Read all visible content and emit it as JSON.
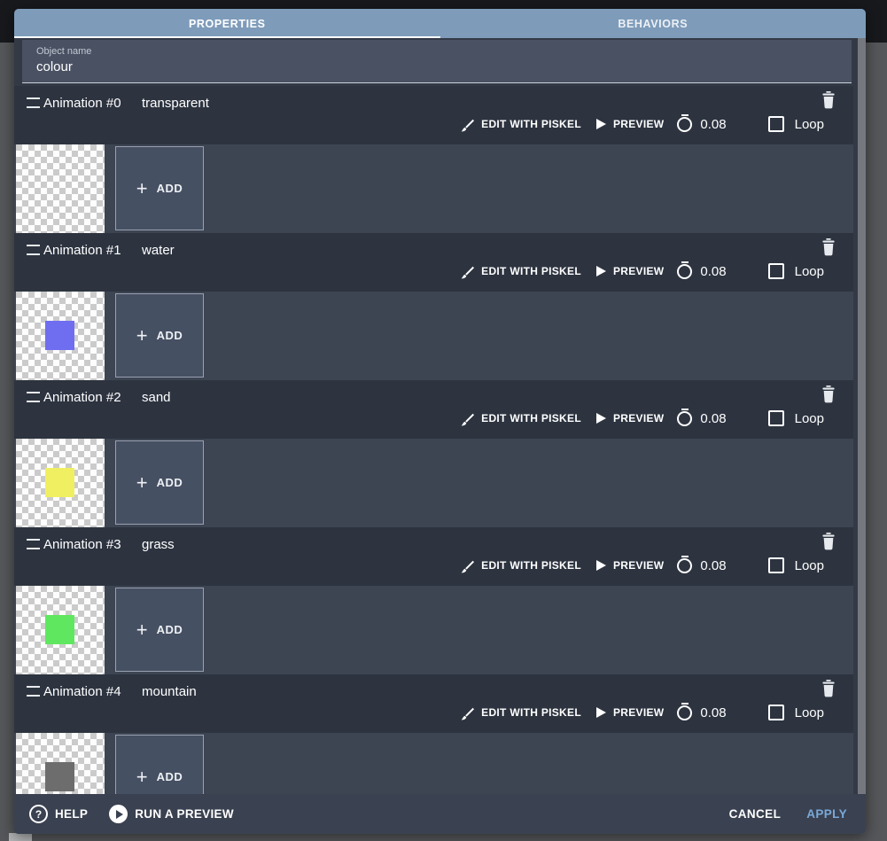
{
  "tabs": {
    "properties": "PROPERTIES",
    "behaviors": "BEHAVIORS"
  },
  "object_name": {
    "label": "Object name",
    "value": "colour"
  },
  "animations": [
    {
      "title": "Animation #0",
      "name": "transparent",
      "color": null,
      "time": "0.08"
    },
    {
      "title": "Animation #1",
      "name": "water",
      "color": "#6f6ef0",
      "time": "0.08"
    },
    {
      "title": "Animation #2",
      "name": "sand",
      "color": "#f0ef62",
      "time": "0.08"
    },
    {
      "title": "Animation #3",
      "name": "grass",
      "color": "#5fe75f",
      "time": "0.08"
    },
    {
      "title": "Animation #4",
      "name": "mountain",
      "color": "#6d6d6d",
      "time": "0.08"
    }
  ],
  "controls": {
    "edit": "EDIT WITH PISKEL",
    "preview": "PREVIEW",
    "loop": "Loop",
    "add": "ADD",
    "add_plus": "+"
  },
  "footer": {
    "help": "HELP",
    "run_preview": "RUN A PREVIEW",
    "cancel": "CANCEL",
    "apply": "APPLY"
  },
  "colors": {
    "tab_bar": "#7e9cba",
    "header_band": "#2d3440",
    "frames_row": "#3d4553",
    "apply_text": "#7aa9d8"
  }
}
